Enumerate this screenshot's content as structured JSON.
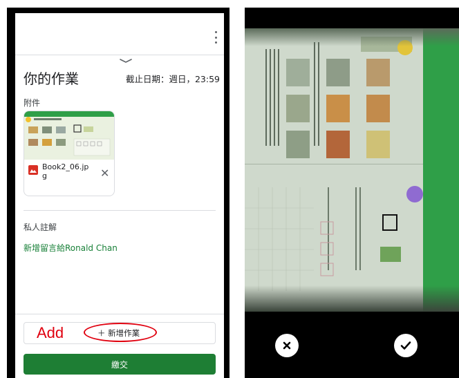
{
  "assignment": {
    "title": "你的作業",
    "due": "截止日期：週日，23:59",
    "attachments_label": "附件",
    "attachment": {
      "file_name": "Book2_06.jpg",
      "file_icon": "image-file-icon"
    },
    "private_notes_label": "私人註解",
    "add_comment": "新增留言給Ronald Chan",
    "annotation": "Add",
    "add_work": "＋ 新增作業",
    "submit": "繳交"
  },
  "camera": {
    "cancel_icon": "close-icon",
    "confirm_icon": "check-icon"
  },
  "colors": {
    "accent_green": "#1e7e34",
    "link_green": "#188038",
    "annotation_red": "#e0000f"
  }
}
